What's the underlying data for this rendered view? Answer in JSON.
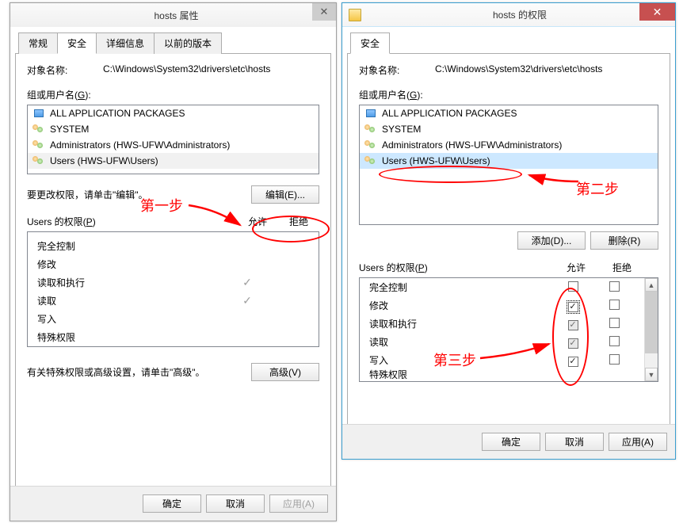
{
  "left": {
    "title": "hosts 属性",
    "tabs": [
      "常规",
      "安全",
      "详细信息",
      "以前的版本"
    ],
    "activeTab": 1,
    "objectNameLabel": "对象名称:",
    "objectName": "C:\\Windows\\System32\\drivers\\etc\\hosts",
    "groupLabelPrefix": "组或用户名(",
    "groupLabelKey": "G",
    "groupLabelSuffix": "):",
    "groups": [
      "ALL APPLICATION PACKAGES",
      "SYSTEM",
      "Administrators (HWS-UFW\\Administrators)",
      "Users (HWS-UFW\\Users)"
    ],
    "editHint": "要更改权限，请单击\"编辑\"。",
    "editBtn": "编辑(E)...",
    "permHeaderPrefix": "Users 的权限(",
    "permHeaderKey": "P",
    "permHeaderSuffix": ")",
    "colAllow": "允许",
    "colDeny": "拒绝",
    "perms": [
      {
        "name": "完全控制",
        "allow": false
      },
      {
        "name": "修改",
        "allow": false
      },
      {
        "name": "读取和执行",
        "allow": true
      },
      {
        "name": "读取",
        "allow": true
      },
      {
        "name": "写入",
        "allow": false
      },
      {
        "name": "特殊权限",
        "allow": false
      }
    ],
    "advancedHint": "有关特殊权限或高级设置，请单击\"高级\"。",
    "advancedBtn": "高级(V)",
    "ok": "确定",
    "cancel": "取消",
    "apply": "应用(A)"
  },
  "right": {
    "title": "hosts 的权限",
    "tab": "安全",
    "objectNameLabel": "对象名称:",
    "objectName": "C:\\Windows\\System32\\drivers\\etc\\hosts",
    "groupLabelPrefix": "组或用户名(",
    "groupLabelKey": "G",
    "groupLabelSuffix": "):",
    "groups": [
      "ALL APPLICATION PACKAGES",
      "SYSTEM",
      "Administrators (HWS-UFW\\Administrators)",
      "Users (HWS-UFW\\Users)"
    ],
    "addBtn": "添加(D)...",
    "removeBtn": "删除(R)",
    "permHeaderPrefix": "Users 的权限(",
    "permHeaderKey": "P",
    "permHeaderSuffix": ")",
    "colAllow": "允许",
    "colDeny": "拒绝",
    "perms": [
      {
        "name": "完全控制",
        "allow": "",
        "deny": ""
      },
      {
        "name": "修改",
        "allow": "checked focus",
        "deny": ""
      },
      {
        "name": "读取和执行",
        "allow": "checked-gray",
        "deny": ""
      },
      {
        "name": "读取",
        "allow": "checked-gray",
        "deny": ""
      },
      {
        "name": "写入",
        "allow": "checked",
        "deny": ""
      },
      {
        "name": "特殊权限",
        "allow": "",
        "deny": ""
      }
    ],
    "ok": "确定",
    "cancel": "取消",
    "apply": "应用(A)"
  },
  "annotations": {
    "step1": "第一步",
    "step2": "第二步",
    "step3": "第三步"
  }
}
